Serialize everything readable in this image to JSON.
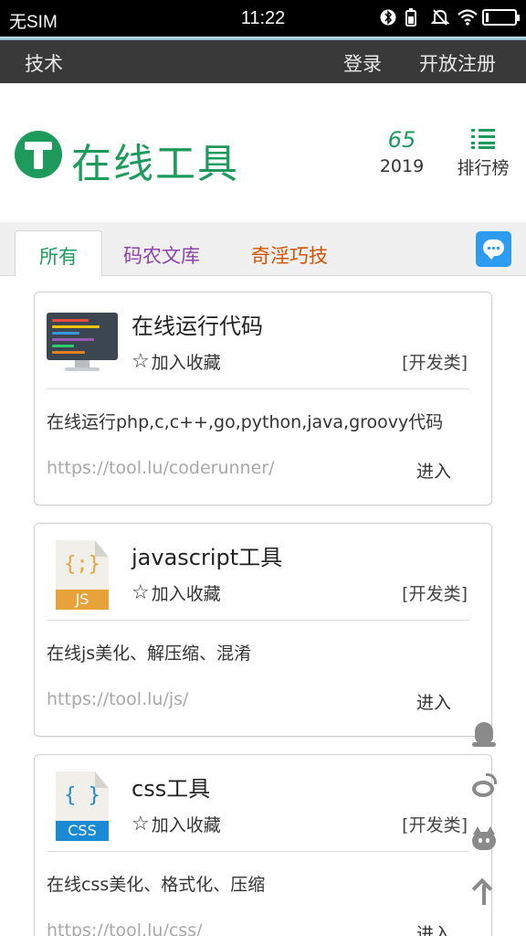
{
  "status_bar": {
    "carrier": "无SIM",
    "time": "11:22",
    "icons": [
      "bluetooth-icon",
      "battery-saver-icon",
      "mute-icon",
      "wifi-icon",
      "battery-icon"
    ]
  },
  "top_nav": {
    "section": "技术",
    "login": "登录",
    "register": "开放注册"
  },
  "header": {
    "logo_text": "在线工具",
    "stat_number": "65",
    "stat_year": "2019",
    "ranking_label": "排行榜"
  },
  "tabs": [
    {
      "label": "所有",
      "active": true,
      "color": "#1e9b5c"
    },
    {
      "label": "码农文库",
      "active": false,
      "color": "#8e44ad"
    },
    {
      "label": "奇淫巧技",
      "active": false,
      "color": "#d35400"
    }
  ],
  "colors": {
    "brand_green": "#1e9b5c",
    "chat_blue": "#2d9cf0",
    "nav_bg": "#393939"
  },
  "cards": [
    {
      "title": "在线运行代码",
      "favorite_label": "加入收藏",
      "category": "[开发类]",
      "description": "在线运行php,c,c++,go,python,java,groovy代码",
      "url": "https://tool.lu/coderunner/",
      "enter_label": "进入",
      "icon": "code-monitor-icon"
    },
    {
      "title": "javascript工具",
      "favorite_label": "加入收藏",
      "category": "[开发类]",
      "description": "在线js美化、解压缩、混淆",
      "url": "https://tool.lu/js/",
      "enter_label": "进入",
      "icon": "js-file-icon",
      "icon_glyph": "{;}",
      "icon_band": "JS"
    },
    {
      "title": "css工具",
      "favorite_label": "加入收藏",
      "category": "[开发类]",
      "description": "在线css美化、格式化、压缩",
      "url": "https://tool.lu/css/",
      "enter_label": "进入",
      "icon": "css-file-icon",
      "icon_glyph": "{ }",
      "icon_band": "CSS"
    }
  ],
  "side_icons": [
    "qq-icon",
    "weibo-icon",
    "github-icon",
    "back-to-top-icon"
  ]
}
